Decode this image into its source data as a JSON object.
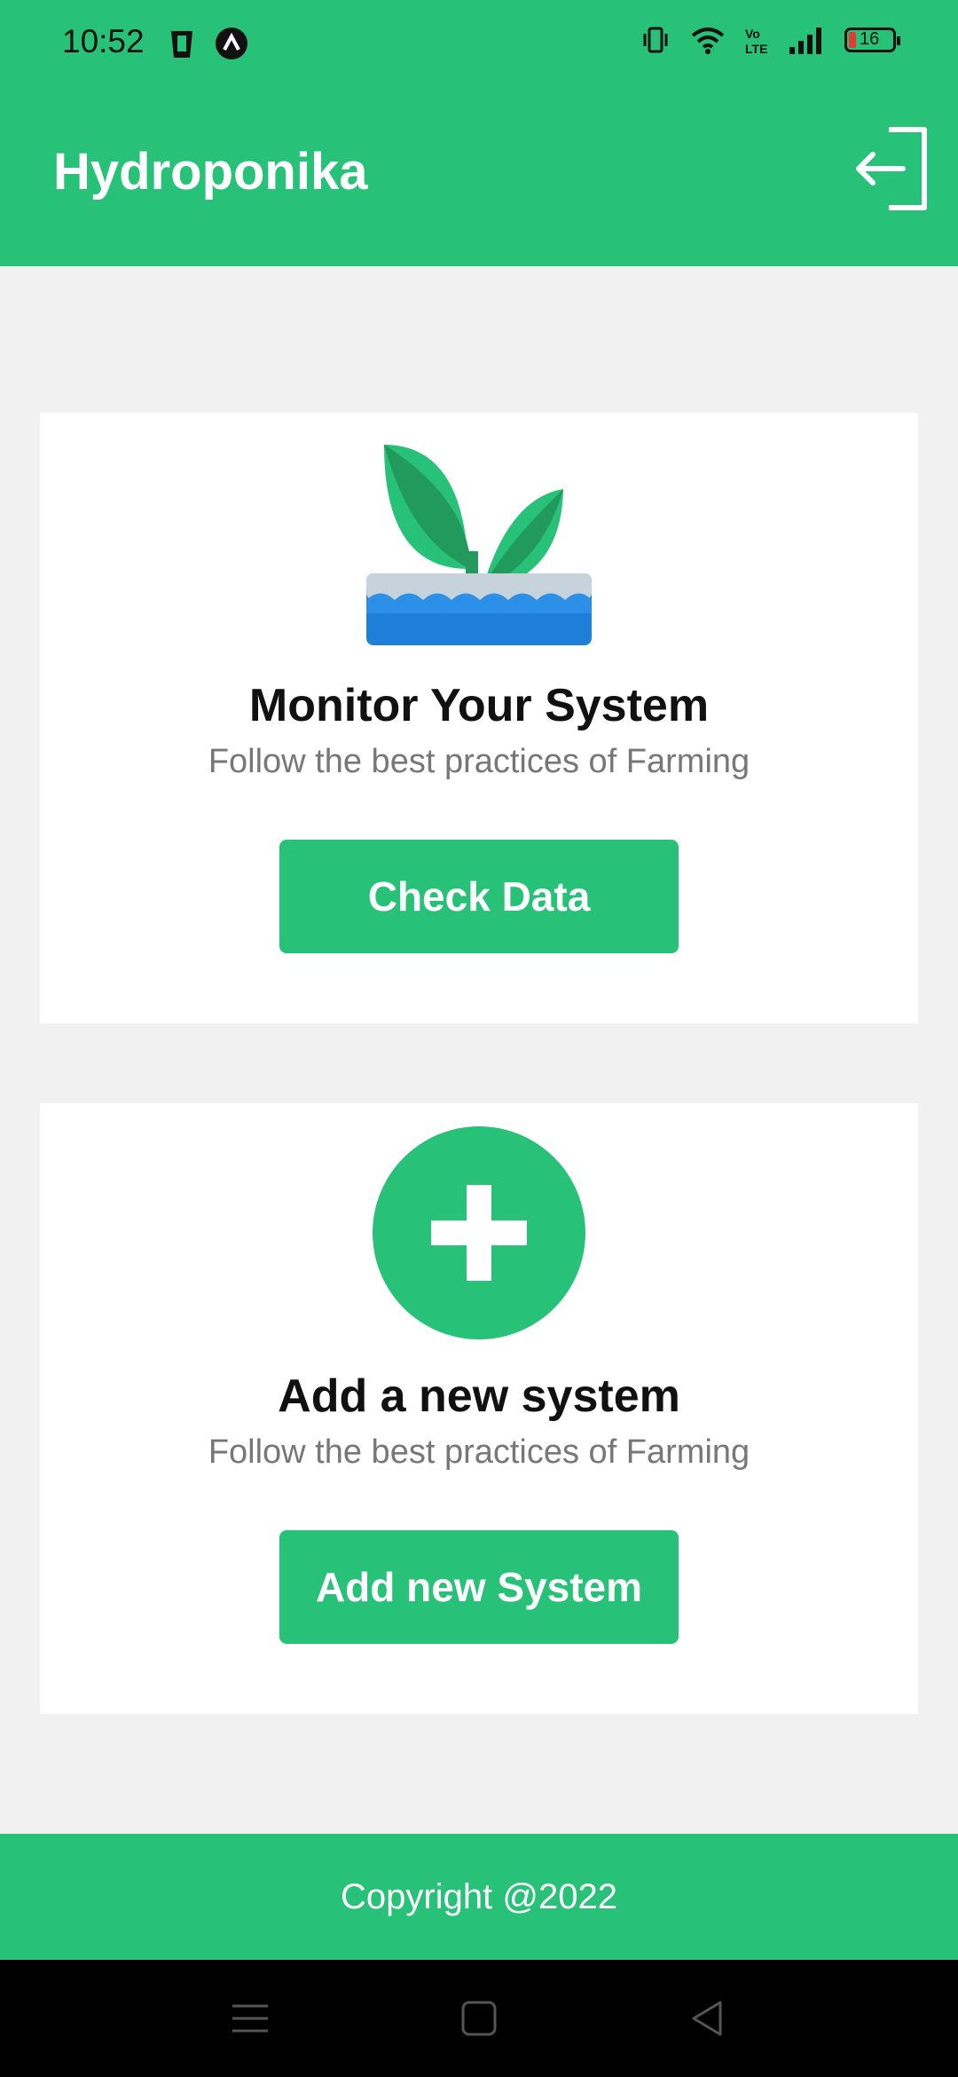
{
  "status_bar": {
    "time": "10:52",
    "battery": "16",
    "icons": [
      "trash-icon",
      "app-a-icon",
      "vibrate-icon",
      "wifi-icon",
      "volte-icon",
      "signal-icon",
      "battery-icon"
    ]
  },
  "app": {
    "title": "Hydroponika",
    "logout_icon": "logout-icon"
  },
  "cards": [
    {
      "icon": "plant-in-water-icon",
      "title": "Monitor Your System",
      "subtitle": "Follow the best practices of Farming",
      "button": "Check Data"
    },
    {
      "icon": "plus-circle-icon",
      "title": "Add a new system",
      "subtitle": "Follow the best practices of Farming",
      "button": "Add new System"
    }
  ],
  "footer": {
    "text": "Copyright @2022"
  },
  "nav": [
    "menu-icon",
    "home-icon",
    "back-icon"
  ],
  "colors": {
    "primary": "#27c277",
    "background": "#f1f1f1"
  }
}
